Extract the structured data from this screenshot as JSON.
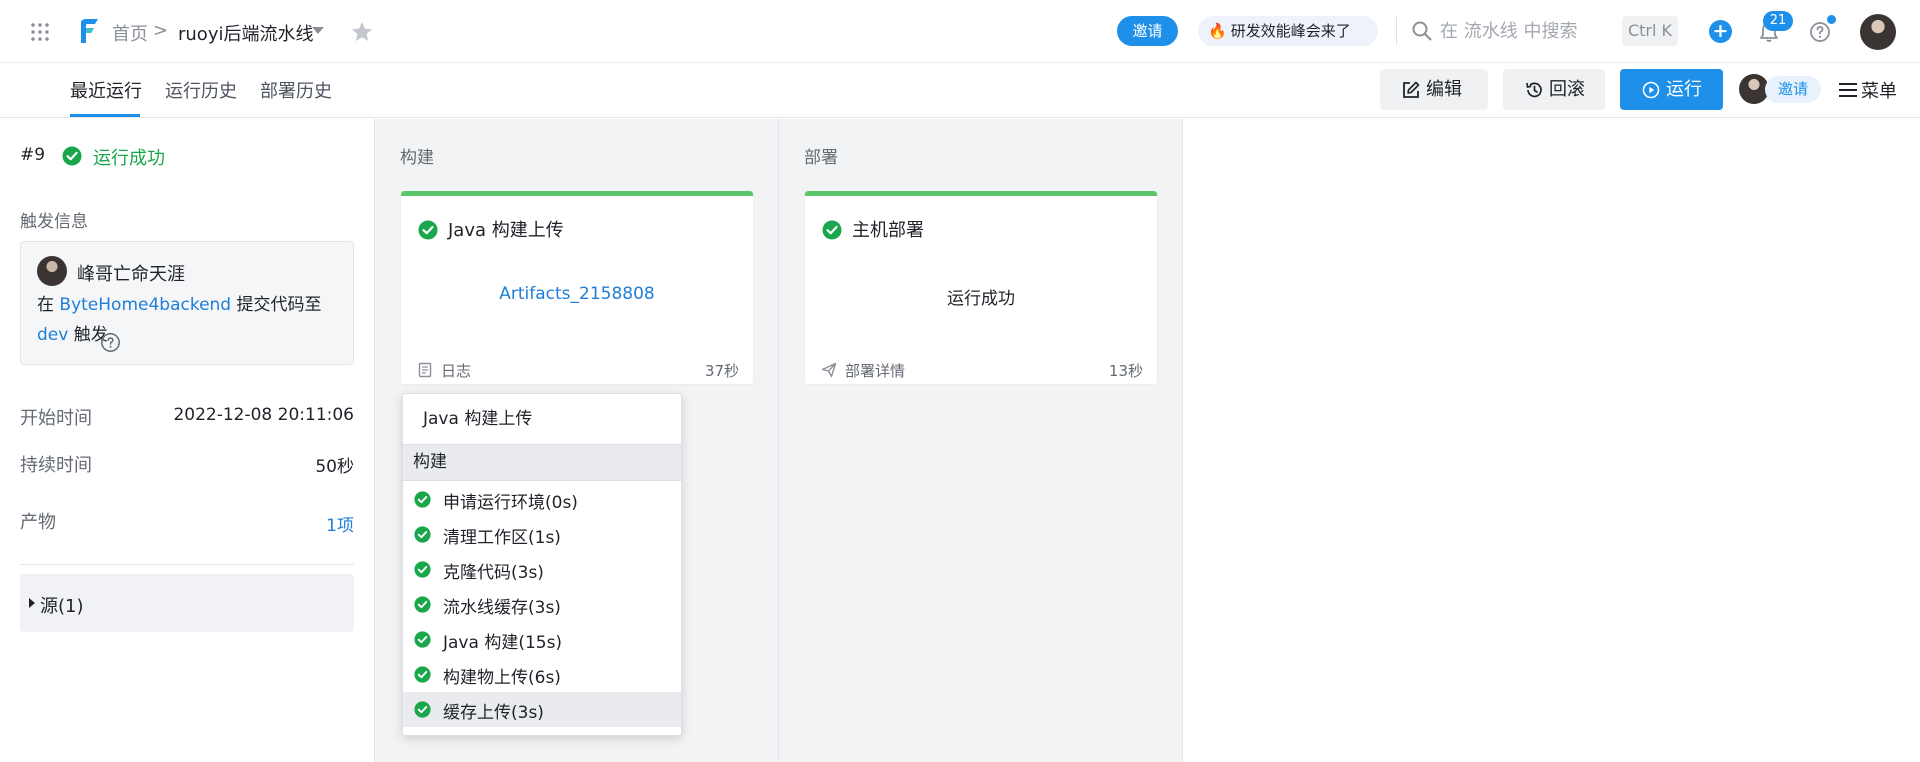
{
  "topbar": {
    "breadcrumb_home": "首页",
    "breadcrumb_sep": ">",
    "breadcrumb_current": "ruoyi后端流水线",
    "invite_label": "邀请",
    "promo_label": "研发效能峰会来了",
    "search_placeholder": "在 流水线 中搜索",
    "shortcut": "Ctrl K",
    "notification_count": "21",
    "icons": [
      "grid-icon",
      "logo-icon",
      "star-icon",
      "fire-icon",
      "search-icon",
      "plus-icon",
      "bell-icon",
      "help-icon"
    ]
  },
  "tabs": [
    {
      "label": "最近运行",
      "active": true
    },
    {
      "label": "运行历史",
      "active": false
    },
    {
      "label": "部署历史",
      "active": false
    }
  ],
  "actions": {
    "edit": "编辑",
    "rollback": "回滚",
    "run": "运行",
    "invite": "邀请",
    "menu": "菜单"
  },
  "run": {
    "number": "#9",
    "status": "运行成功",
    "trigger_title": "触发信息",
    "trigger_user": "峰哥亡命天涯",
    "trigger_in": "在",
    "trigger_repo": "ByteHome4backend",
    "trigger_action": "提交代码至",
    "trigger_branch": "dev",
    "trigger_suffix": "触发",
    "start_label": "开始时间",
    "start_value": "2022-12-08 20:11:06",
    "duration_label": "持续时间",
    "duration_value": "50秒",
    "artifacts_label": "产物",
    "artifacts_value": "1项",
    "source_label": "源(1)"
  },
  "stages": [
    {
      "title": "构建",
      "job": {
        "name": "Java 构建上传",
        "center": "Artifacts_2158808",
        "foot_label": "日志",
        "foot_duration": "37秒"
      }
    },
    {
      "title": "部署",
      "job": {
        "name": "主机部署",
        "center": "运行成功",
        "foot_label": "部署详情",
        "foot_duration": "13秒"
      }
    }
  ],
  "dropdown": {
    "title": "Java 构建上传",
    "group": "构建",
    "steps": [
      "申请运行环境(0s)",
      "清理工作区(1s)",
      "克隆代码(3s)",
      "流水线缓存(3s)",
      "Java 构建(15s)",
      "构建物上传(6s)",
      "缓存上传(3s)"
    ],
    "selected_index": 6
  },
  "colors": {
    "accent": "#1e90ea",
    "success": "#1aa64a",
    "stage_bar": "#5bc76b",
    "link": "#1e7ed8"
  }
}
